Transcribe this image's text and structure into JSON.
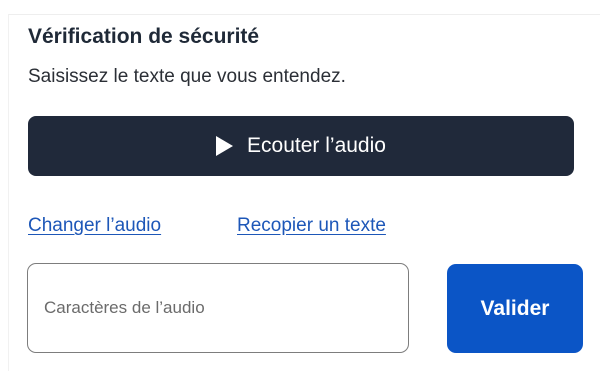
{
  "captcha": {
    "title": "Vérification de sécurité",
    "instruction": "Saisissez le texte que vous entendez.",
    "play_button": {
      "icon": "play-icon",
      "label": "Ecouter l’audio"
    },
    "links": {
      "change_audio": "Changer l’audio",
      "retype_text": "Recopier un texte"
    },
    "input": {
      "placeholder": "Caractères de l’audio",
      "value": ""
    },
    "submit_label": "Valider"
  },
  "colors": {
    "play_button_bg": "#20293a",
    "link": "#1d57b8",
    "submit_bg": "#0b55c6",
    "title_text": "#1f2937"
  }
}
